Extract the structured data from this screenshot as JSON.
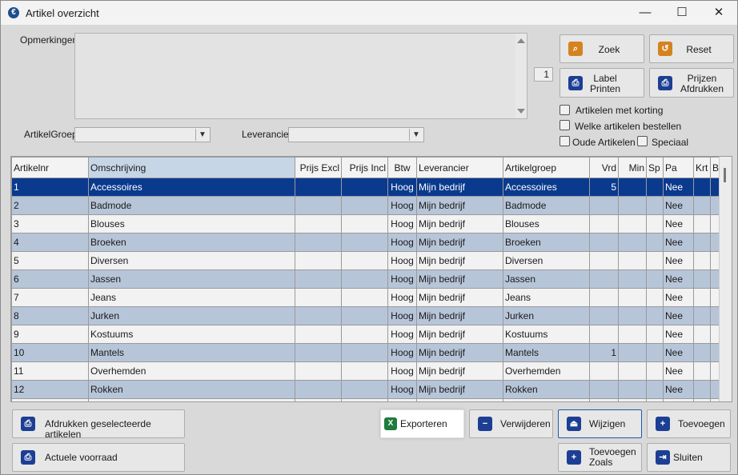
{
  "window": {
    "title": "Artikel overzicht",
    "minimize": "—",
    "maximize": "☐",
    "close": "✕"
  },
  "filters": {
    "remarks_label": "Opmerkingen",
    "remarks_value": "",
    "counter": "1",
    "group_label": "ArtikelGroep",
    "group_value": "",
    "supplier_label": "Leverancier",
    "supplier_value": ""
  },
  "side_buttons": {
    "search": "Zoek",
    "reset": "Reset",
    "label_print": [
      "Label",
      "Printen"
    ],
    "price_print": [
      "Prijzen",
      "Afdrukken"
    ]
  },
  "checkboxes": {
    "discount": "Artikelen met korting",
    "order": "Welke artikelen bestellen",
    "old": "Oude Artikelen",
    "special": "Speciaal"
  },
  "table": {
    "columns": [
      "Artikelnr",
      "Omschrijving",
      "Prijs Excl",
      "Prijs Incl",
      "Btw",
      "Leverancier",
      "Artikelgroep",
      "Vrd",
      "Min",
      "Sp",
      "Pa",
      "Krt",
      "B"
    ],
    "rows": [
      [
        "1",
        "Accessoires",
        "",
        "",
        "Hoog",
        "Mijn bedrijf",
        "Accessoires",
        "5",
        "",
        "",
        "Nee",
        "",
        ""
      ],
      [
        "2",
        "Badmode",
        "",
        "",
        "Hoog",
        "Mijn bedrijf",
        "Badmode",
        "",
        "",
        "",
        "Nee",
        "",
        ""
      ],
      [
        "3",
        "Blouses",
        "",
        "",
        "Hoog",
        "Mijn bedrijf",
        "Blouses",
        "",
        "",
        "",
        "Nee",
        "",
        ""
      ],
      [
        "4",
        "Broeken",
        "",
        "",
        "Hoog",
        "Mijn bedrijf",
        "Broeken",
        "",
        "",
        "",
        "Nee",
        "",
        ""
      ],
      [
        "5",
        "Diversen",
        "",
        "",
        "Hoog",
        "Mijn bedrijf",
        "Diversen",
        "",
        "",
        "",
        "Nee",
        "",
        ""
      ],
      [
        "6",
        "Jassen",
        "",
        "",
        "Hoog",
        "Mijn bedrijf",
        "Jassen",
        "",
        "",
        "",
        "Nee",
        "",
        ""
      ],
      [
        "7",
        "Jeans",
        "",
        "",
        "Hoog",
        "Mijn bedrijf",
        "Jeans",
        "",
        "",
        "",
        "Nee",
        "",
        ""
      ],
      [
        "8",
        "Jurken",
        "",
        "",
        "Hoog",
        "Mijn bedrijf",
        "Jurken",
        "",
        "",
        "",
        "Nee",
        "",
        ""
      ],
      [
        "9",
        "Kostuums",
        "",
        "",
        "Hoog",
        "Mijn bedrijf",
        "Kostuums",
        "",
        "",
        "",
        "Nee",
        "",
        ""
      ],
      [
        "10",
        "Mantels",
        "",
        "",
        "Hoog",
        "Mijn bedrijf",
        "Mantels",
        "1",
        "",
        "",
        "Nee",
        "",
        ""
      ],
      [
        "11",
        "Overhemden",
        "",
        "",
        "Hoog",
        "Mijn bedrijf",
        "Overhemden",
        "",
        "",
        "",
        "Nee",
        "",
        ""
      ],
      [
        "12",
        "Rokken",
        "",
        "",
        "Hoog",
        "Mijn bedrijf",
        "Rokken",
        "",
        "",
        "",
        "Nee",
        "",
        ""
      ],
      [
        "",
        "",
        "",
        "",
        "",
        "",
        "",
        "",
        "",
        "",
        "",
        "",
        ""
      ]
    ]
  },
  "bottom_buttons": {
    "print_selected": "Afdrukken geselecteerde artikelen",
    "current_stock": "Actuele voorraad",
    "export": "Exporteren",
    "delete": "Verwijderen",
    "edit": "Wijzigen",
    "add": "Toevoegen",
    "add_as": [
      "Toevoegen",
      "Zoals"
    ],
    "close": "Sluiten"
  },
  "colors": {
    "selection": "#0a3a8e",
    "alt_row": "#b7c5d9",
    "accent_icon": "#1c3f94"
  }
}
